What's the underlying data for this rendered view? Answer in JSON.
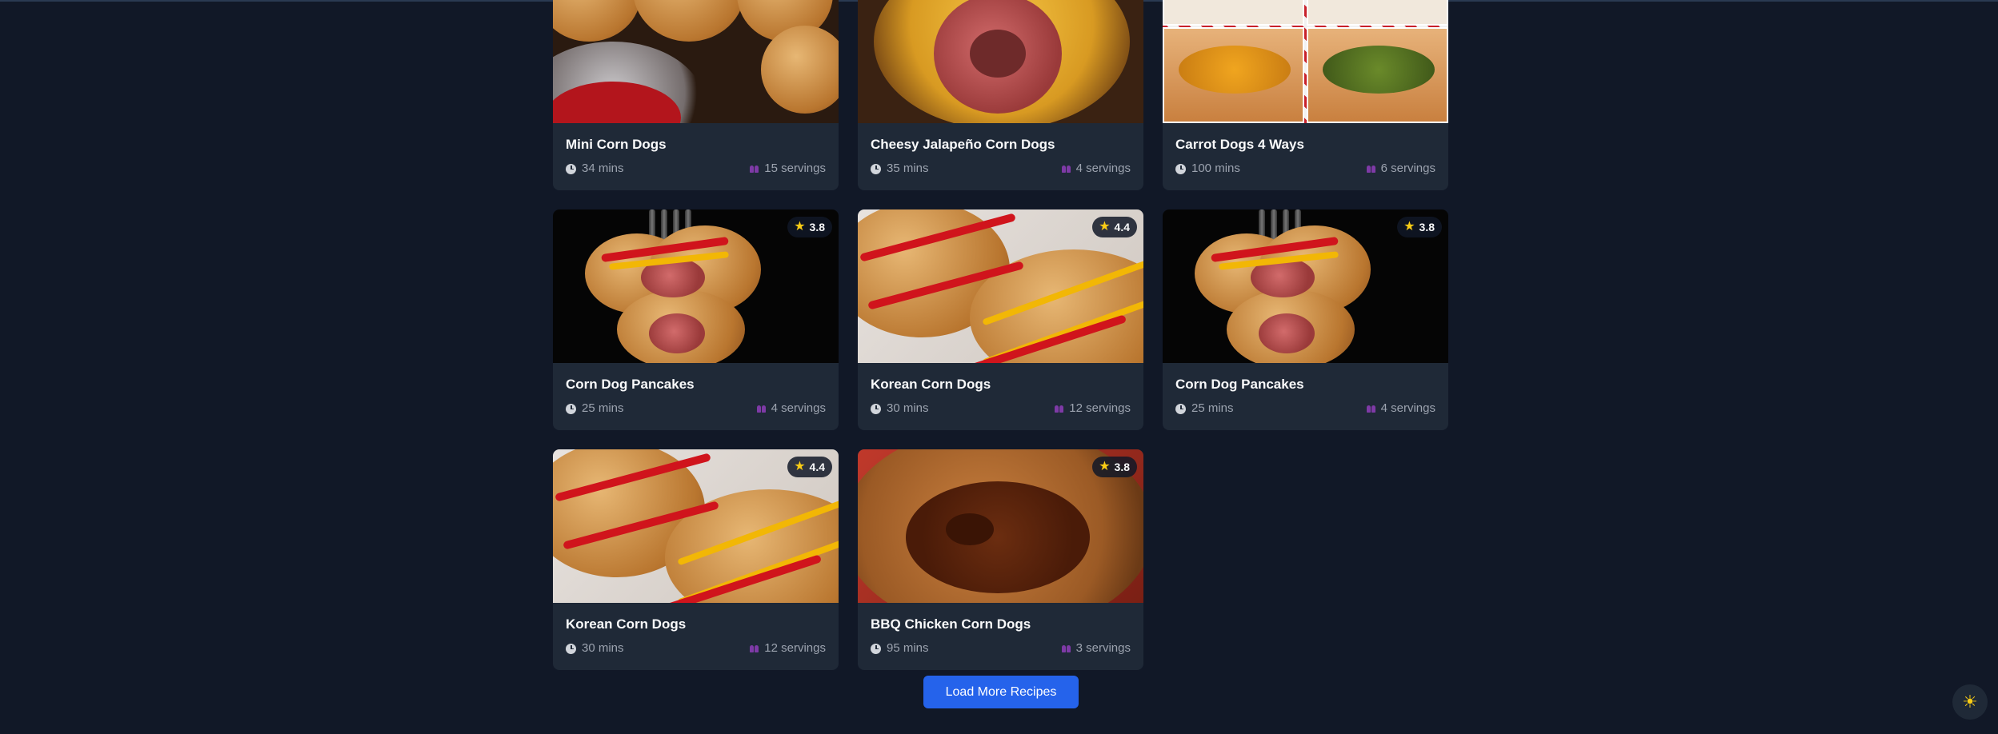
{
  "recipes": [
    {
      "title": "Mini Corn Dogs",
      "time": "34 mins",
      "servings": "15 servings",
      "rating": null,
      "image": "mini-corn-dogs-image"
    },
    {
      "title": "Cheesy Jalapeño Corn Dogs",
      "time": "35 mins",
      "servings": "4 servings",
      "rating": null,
      "image": "cheesy-jalapeno-image"
    },
    {
      "title": "Carrot Dogs 4 Ways",
      "time": "100 mins",
      "servings": "6 servings",
      "rating": null,
      "image": "carrot-dogs-image"
    },
    {
      "title": "Corn Dog Pancakes",
      "time": "25 mins",
      "servings": "4 servings",
      "rating": "3.8",
      "image": "corn-dog-pancakes-image"
    },
    {
      "title": "Korean Corn Dogs",
      "time": "30 mins",
      "servings": "12 servings",
      "rating": "4.4",
      "image": "korean-corn-dogs-image"
    },
    {
      "title": "Corn Dog Pancakes",
      "time": "25 mins",
      "servings": "4 servings",
      "rating": "3.8",
      "image": "corn-dog-pancakes-image"
    },
    {
      "title": "Korean Corn Dogs",
      "time": "30 mins",
      "servings": "12 servings",
      "rating": "4.4",
      "image": "korean-corn-dogs-image"
    },
    {
      "title": "BBQ Chicken Corn Dogs",
      "time": "95 mins",
      "servings": "3 servings",
      "rating": "3.8",
      "image": "bbq-chicken-image"
    }
  ],
  "load_more_label": "Load More Recipes",
  "theme_toggle_icon": "sun-icon",
  "colors": {
    "background": "#111827",
    "card": "#1f2937",
    "accent": "#2563eb",
    "star": "#facc15",
    "servings_icon": "#7e3aa6"
  }
}
